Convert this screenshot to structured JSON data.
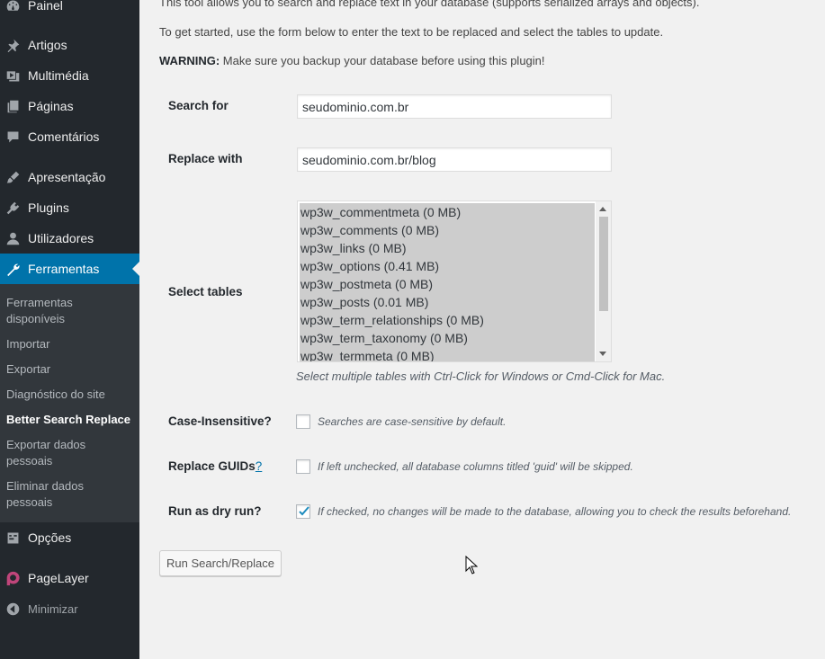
{
  "sidebar": {
    "items": [
      {
        "label": "Painel",
        "icon": "dashboard-icon"
      },
      {
        "label": "Artigos",
        "icon": "pin-icon"
      },
      {
        "label": "Multimédia",
        "icon": "media-icon"
      },
      {
        "label": "Páginas",
        "icon": "pages-icon"
      },
      {
        "label": "Comentários",
        "icon": "comment-icon"
      },
      {
        "label": "Apresentação",
        "icon": "appearance-icon"
      },
      {
        "label": "Plugins",
        "icon": "plugin-icon"
      },
      {
        "label": "Utilizadores",
        "icon": "user-icon"
      },
      {
        "label": "Ferramentas",
        "icon": "wrench-icon"
      },
      {
        "label": "Opções",
        "icon": "settings-icon"
      },
      {
        "label": "PageLayer",
        "icon": "pagelayer-icon"
      },
      {
        "label": "Minimizar",
        "icon": "collapse-icon"
      }
    ],
    "submenu": [
      "Ferramentas disponíveis",
      "Importar",
      "Exportar",
      "Diagnóstico do site",
      "Better Search Replace",
      "Exportar dados pessoais",
      "Eliminar dados pessoais"
    ]
  },
  "intro": {
    "line1": "This tool allows you to search and replace text in your database (supports serialized arrays and objects).",
    "line2": "To get started, use the form below to enter the text to be replaced and select the tables to update.",
    "warning_label": "WARNING:",
    "warning_text": " Make sure you backup your database before using this plugin!"
  },
  "form": {
    "search_label": "Search for",
    "search_value": "seudominio.com.br",
    "replace_label": "Replace with",
    "replace_value": "seudominio.com.br/blog",
    "tables_label": "Select tables",
    "tables": [
      "wp3w_commentmeta (0 MB)",
      "wp3w_comments (0 MB)",
      "wp3w_links (0 MB)",
      "wp3w_options (0.41 MB)",
      "wp3w_postmeta (0 MB)",
      "wp3w_posts (0.01 MB)",
      "wp3w_term_relationships (0 MB)",
      "wp3w_term_taxonomy (0 MB)",
      "wp3w_termmeta (0 MB)"
    ],
    "tables_help": "Select multiple tables with Ctrl-Click for Windows or Cmd-Click for Mac.",
    "case_label": "Case-Insensitive?",
    "case_help": "Searches are case-sensitive by default.",
    "case_checked": false,
    "guids_label": "Replace GUIDs",
    "guids_link": "?",
    "guids_help": "If left unchecked, all database columns titled 'guid' will be skipped.",
    "guids_checked": false,
    "dry_label": "Run as dry run?",
    "dry_help": "If checked, no changes will be made to the database, allowing you to check the results beforehand.",
    "dry_checked": true,
    "submit_label": "Run Search/Replace"
  },
  "colors": {
    "sidebar_bg": "#23282d",
    "submenu_bg": "#32373c",
    "accent": "#0073aa",
    "page_bg": "#f1f1f1"
  }
}
